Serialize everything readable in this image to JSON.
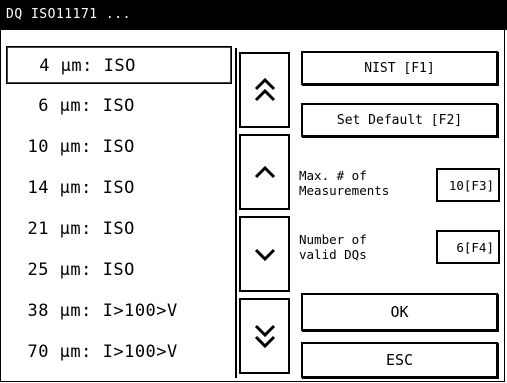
{
  "window": {
    "title": "DQ ISO11171 ..."
  },
  "list": {
    "items": [
      {
        "label": "   4 µm: ISO"
      },
      {
        "label": "   6 µm: ISO"
      },
      {
        "label": "  10 µm: ISO"
      },
      {
        "label": "  14 µm: ISO"
      },
      {
        "label": "  21 µm: ISO"
      },
      {
        "label": "  25 µm: ISO"
      },
      {
        "label": "  38 µm: I>100>V"
      },
      {
        "label": "  70 µm: I>100>V"
      }
    ],
    "selected_index": 0
  },
  "scroll": {
    "page_up_icon": "double-chevron-up-icon",
    "up_icon": "chevron-up-icon",
    "down_icon": "chevron-down-icon",
    "page_down_icon": "double-chevron-down-icon"
  },
  "buttons": {
    "nist": "NIST [F1]",
    "set_default": "Set Default [F2]",
    "ok": "OK",
    "esc": "ESC"
  },
  "settings": {
    "max_measurements_label": "Max. # of\nMeasurements",
    "max_measurements_value": "10[F3]",
    "valid_dqs_label": "Number of\nvalid DQs",
    "valid_dqs_value": "6[F4]"
  }
}
